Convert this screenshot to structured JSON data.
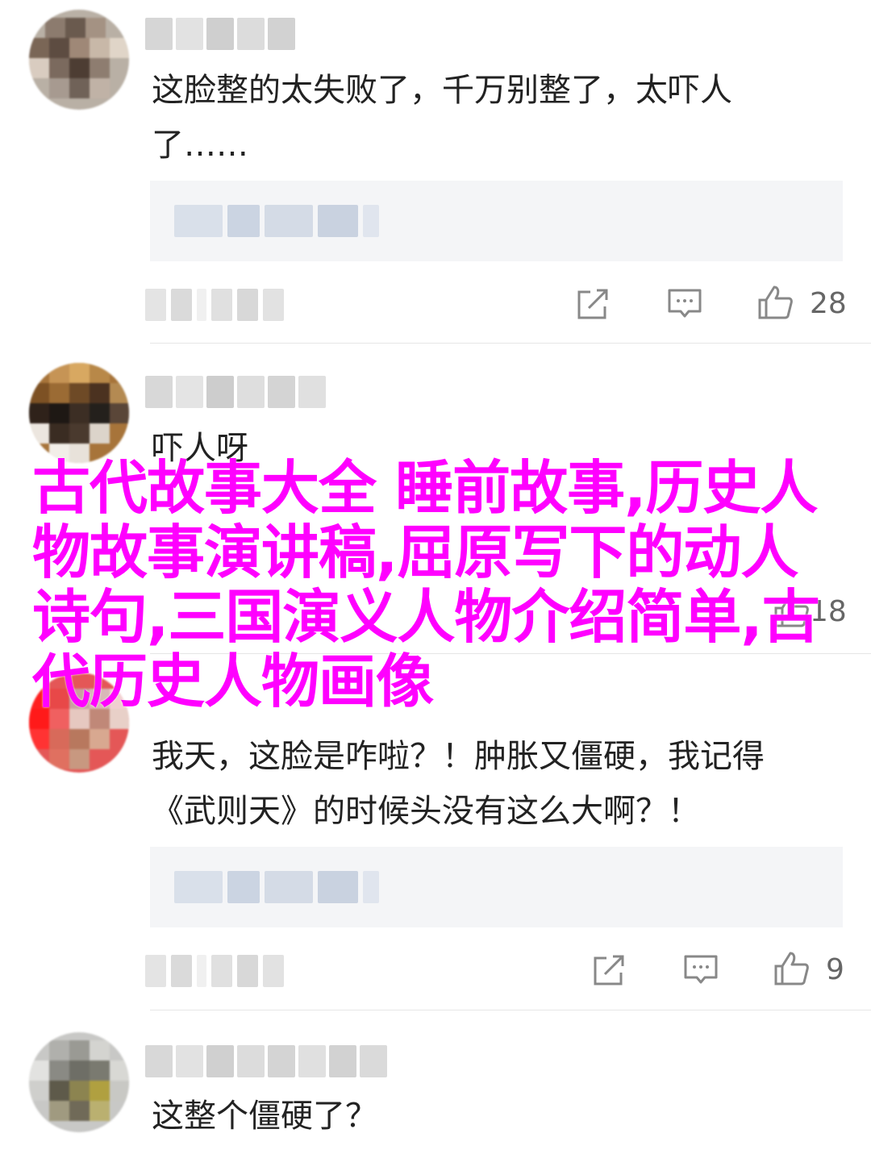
{
  "comments": [
    {
      "text": "这脸整的太失败了，千万别整了，太吓人\n了……",
      "likes": "28"
    },
    {
      "text": "吓人呀",
      "likes": "18"
    },
    {
      "text": "我天，这脸是咋啦？！肿胀又僵硬，我记得\n《武则天》的时候头没有这么大啊？！",
      "likes": "9"
    },
    {
      "text": "这整个僵硬了？"
    }
  ],
  "overlay_title": "古代故事大全 睡前故事,历史人物故事演讲稿,屈原写下的动人诗句,三国演义人物介绍简单,古代历史人物画像",
  "icons": {
    "share": "share-icon",
    "reply": "comment-icon",
    "like": "thumbs-up-icon"
  },
  "colors": {
    "overlay_text": "#ff00ff",
    "quote_bg": "#f4f5f7",
    "icon_gray": "#888888"
  }
}
